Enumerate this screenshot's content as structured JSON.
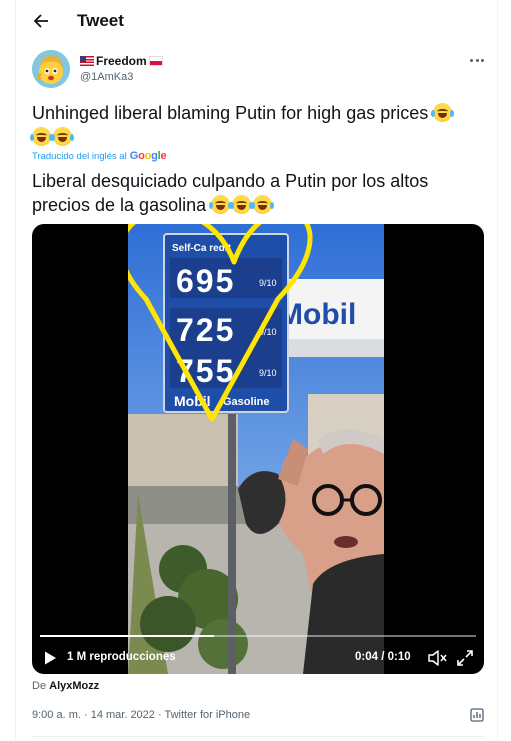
{
  "header": {
    "title": "Tweet"
  },
  "author": {
    "display_name": "Freedom",
    "handle": "@1AmKa3"
  },
  "tweet": {
    "text": "Unhinged liberal blaming Putin for high gas prices",
    "translated_by_prefix": "Traducido del inglés al",
    "translated_by_brand": "Google",
    "translated_text_line1": "Liberal desquiciado culpando a Putin por los altos",
    "translated_text_line2": "precios de la gasolina"
  },
  "video": {
    "views": "1 M reproducciones",
    "time": "0:04 / 0:10",
    "progress": 0.4,
    "sign": {
      "top_label": "Self-Ca  redit",
      "prices": [
        {
          "main": "695",
          "frac": "9/10"
        },
        {
          "main": "725",
          "frac": "9/10"
        },
        {
          "main": "755",
          "frac": "9/10"
        }
      ],
      "brand": "Mobil",
      "brand_sub": "Gasoline",
      "bg_brand": "Mobil"
    }
  },
  "source": {
    "prefix": "De",
    "user": "AlyxMozz"
  },
  "meta": {
    "time": "9:00 a. m.",
    "date": "14 mar. 2022",
    "client": "Twitter for iPhone"
  },
  "colors": {
    "accent": "#1d9bf0",
    "heart": "#ffe500",
    "sign_blue": "#1f4ea8"
  }
}
